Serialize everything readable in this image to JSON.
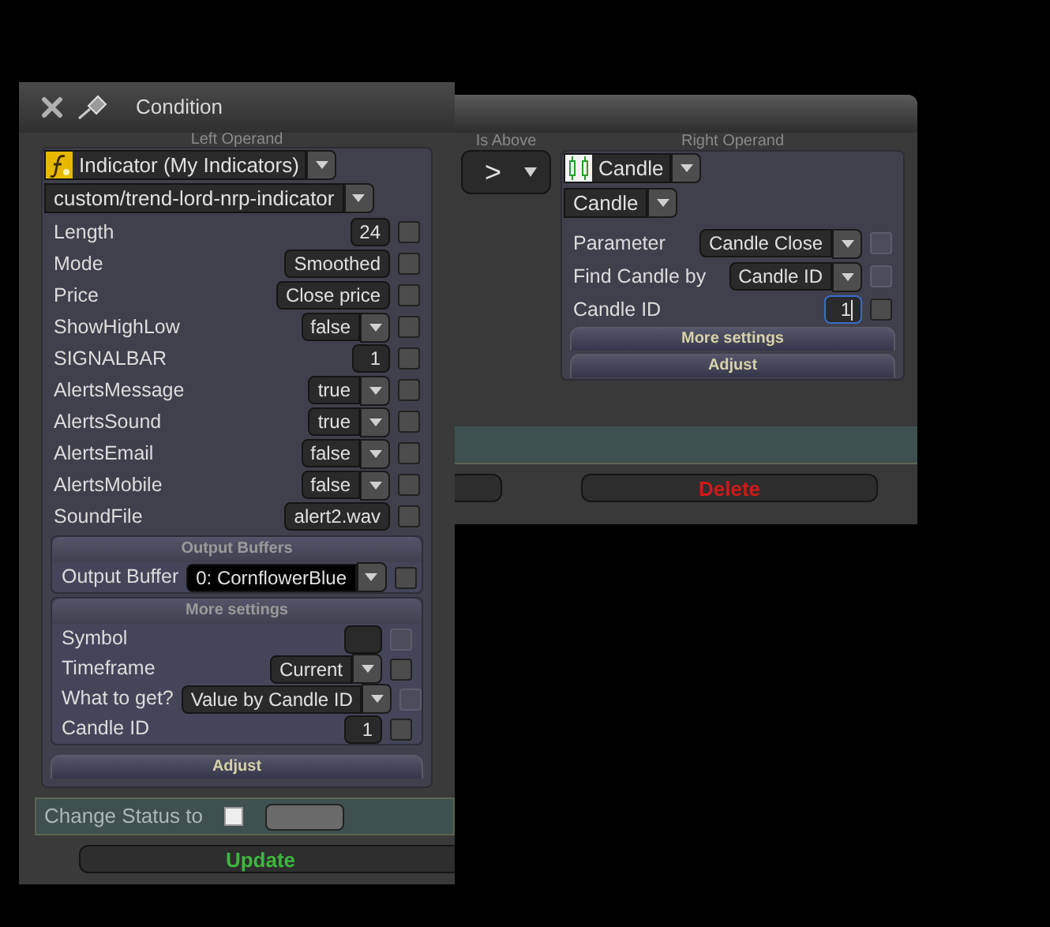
{
  "back_window": {
    "operator_label": "Is Above",
    "operator": ">",
    "right_operand_label": "Right Operand",
    "operand_type": "Candle",
    "operand_subtype": "Candle",
    "params": [
      {
        "kind": "dropdown",
        "label": "Parameter",
        "value": "Candle Close",
        "checked": false,
        "disabled": true,
        "focused": false
      },
      {
        "kind": "dropdown",
        "label": "Find Candle by",
        "value": "Candle ID",
        "checked": false,
        "disabled": true,
        "focused": false
      },
      {
        "kind": "input",
        "label": "Candle ID",
        "value": "1",
        "checked": false,
        "disabled": false,
        "focused": true
      }
    ],
    "section_buttons": [
      "More settings",
      "Adjust"
    ],
    "delete_button": "Delete"
  },
  "window": {
    "title": "Condition",
    "left_operand_label": "Left Operand",
    "indicator": "Indicator (My Indicators)",
    "indicator_path": "custom/trend-lord-nrp-indicator",
    "params": [
      {
        "kind": "input",
        "label": "Length",
        "value": "24",
        "checked": false,
        "disabled": false
      },
      {
        "kind": "input",
        "label": "Mode",
        "value": "Smoothed",
        "checked": false,
        "disabled": false
      },
      {
        "kind": "input",
        "label": "Price",
        "value": "Close price",
        "checked": false,
        "disabled": false
      },
      {
        "kind": "dropdown",
        "label": "ShowHighLow",
        "value": "false",
        "checked": false,
        "disabled": false
      },
      {
        "kind": "input",
        "label": "SIGNALBAR",
        "value": "1",
        "checked": false,
        "disabled": false
      },
      {
        "kind": "dropdown",
        "label": "AlertsMessage",
        "value": "true",
        "checked": false,
        "disabled": false
      },
      {
        "kind": "dropdown",
        "label": "AlertsSound",
        "value": "true",
        "checked": false,
        "disabled": false
      },
      {
        "kind": "dropdown",
        "label": "AlertsEmail",
        "value": "false",
        "checked": false,
        "disabled": false
      },
      {
        "kind": "dropdown",
        "label": "AlertsMobile",
        "value": "false",
        "checked": false,
        "disabled": false
      },
      {
        "kind": "input",
        "label": "SoundFile",
        "value": "alert2.wav",
        "checked": false,
        "disabled": false
      }
    ],
    "output_buffers": {
      "title": "Output Buffers",
      "rows": [
        {
          "kind": "dropdown",
          "label": "Output Buffer",
          "value": "0: CornflowerBlue",
          "checked": false,
          "disabled": false
        }
      ]
    },
    "more_settings": {
      "title": "More settings",
      "rows": [
        {
          "kind": "input",
          "label": "Symbol",
          "checked": false,
          "disabled": true
        },
        {
          "kind": "dropdown",
          "label": "Timeframe",
          "value": "Current",
          "checked": false,
          "disabled": false
        },
        {
          "kind": "dropdown",
          "label": "What to get?",
          "value": "Value by Candle ID",
          "checked": false,
          "disabled": true
        },
        {
          "kind": "input",
          "label": "Candle ID",
          "value": "1",
          "checked": false,
          "disabled": false
        }
      ]
    },
    "adjust_button": "Adjust",
    "change_status": {
      "label": "Change Status to",
      "checked": false
    },
    "update_button": "Update"
  }
}
